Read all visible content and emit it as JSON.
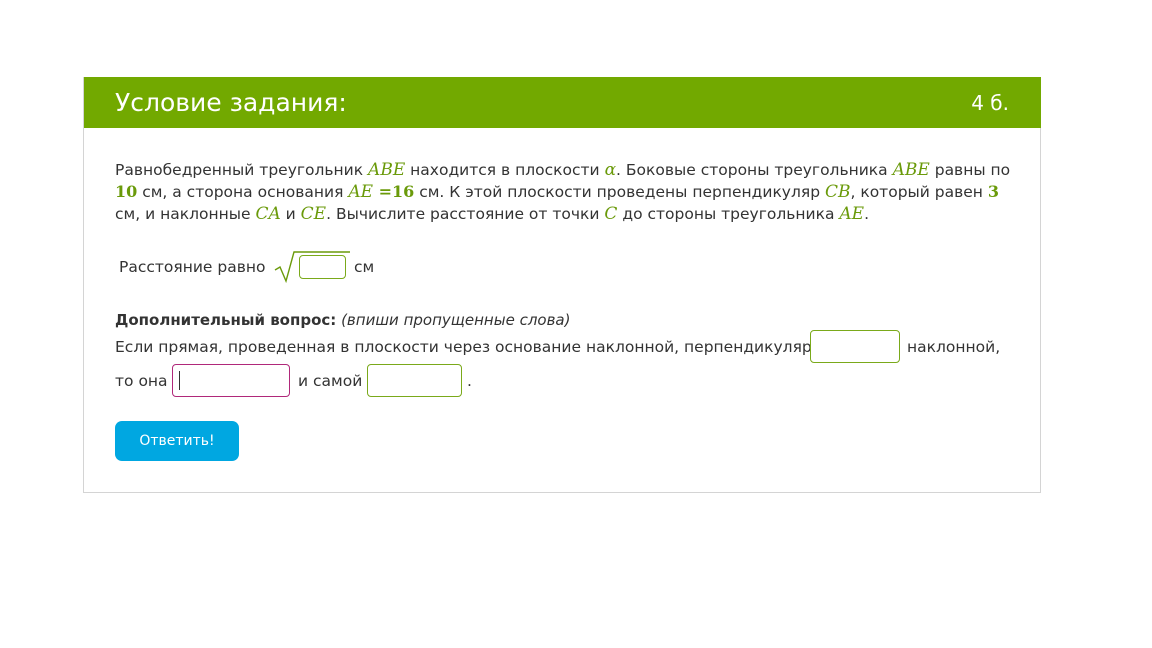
{
  "header": {
    "title": "Условие задания:",
    "points": "4 б."
  },
  "problem": {
    "t1": "Равнобедренный треугольник ",
    "m1": "ABE",
    "t2": " находится в плоскости ",
    "m2": "α",
    "t3": ". Боковые стороны треугольника ",
    "m3": "ABE",
    "t4": " равны по ",
    "n1": "10",
    "t5": " см, а сторона основания ",
    "m4": "AE",
    "eq": " =",
    "n2": "16",
    "t6": " см. К этой плоскости проведены перпендикуляр ",
    "m5": "CB",
    "t7": ", который равен ",
    "n3": "3",
    "t8": " см, и наклонные ",
    "m6": "CA",
    "t9": " и ",
    "m7": "CE",
    "t10": ". Вычислите расстояние от точки ",
    "m8": "C",
    "t11": " до стороны треугольника ",
    "m9": "AE",
    "t12": "."
  },
  "answer": {
    "label": "Расстояние равно",
    "value": "",
    "unit": "см"
  },
  "extra": {
    "head_bold": "Дополнительный вопрос:",
    "head_italic": "(впиши пропущенные слова)",
    "line1": "Если прямая, проведенная в плоскости через основание наклонной, перпендикулярна",
    "line1_end": "наклонной,",
    "line2a": "то она",
    "line2b": "и самой",
    "line2c": ".",
    "input1": "",
    "input2": "",
    "input3": ""
  },
  "button": {
    "label": "Ответить!"
  },
  "colors": {
    "header": "#72a900",
    "math": "#6a9a0a",
    "button": "#00a7e1",
    "active_input": "#b0287a"
  }
}
